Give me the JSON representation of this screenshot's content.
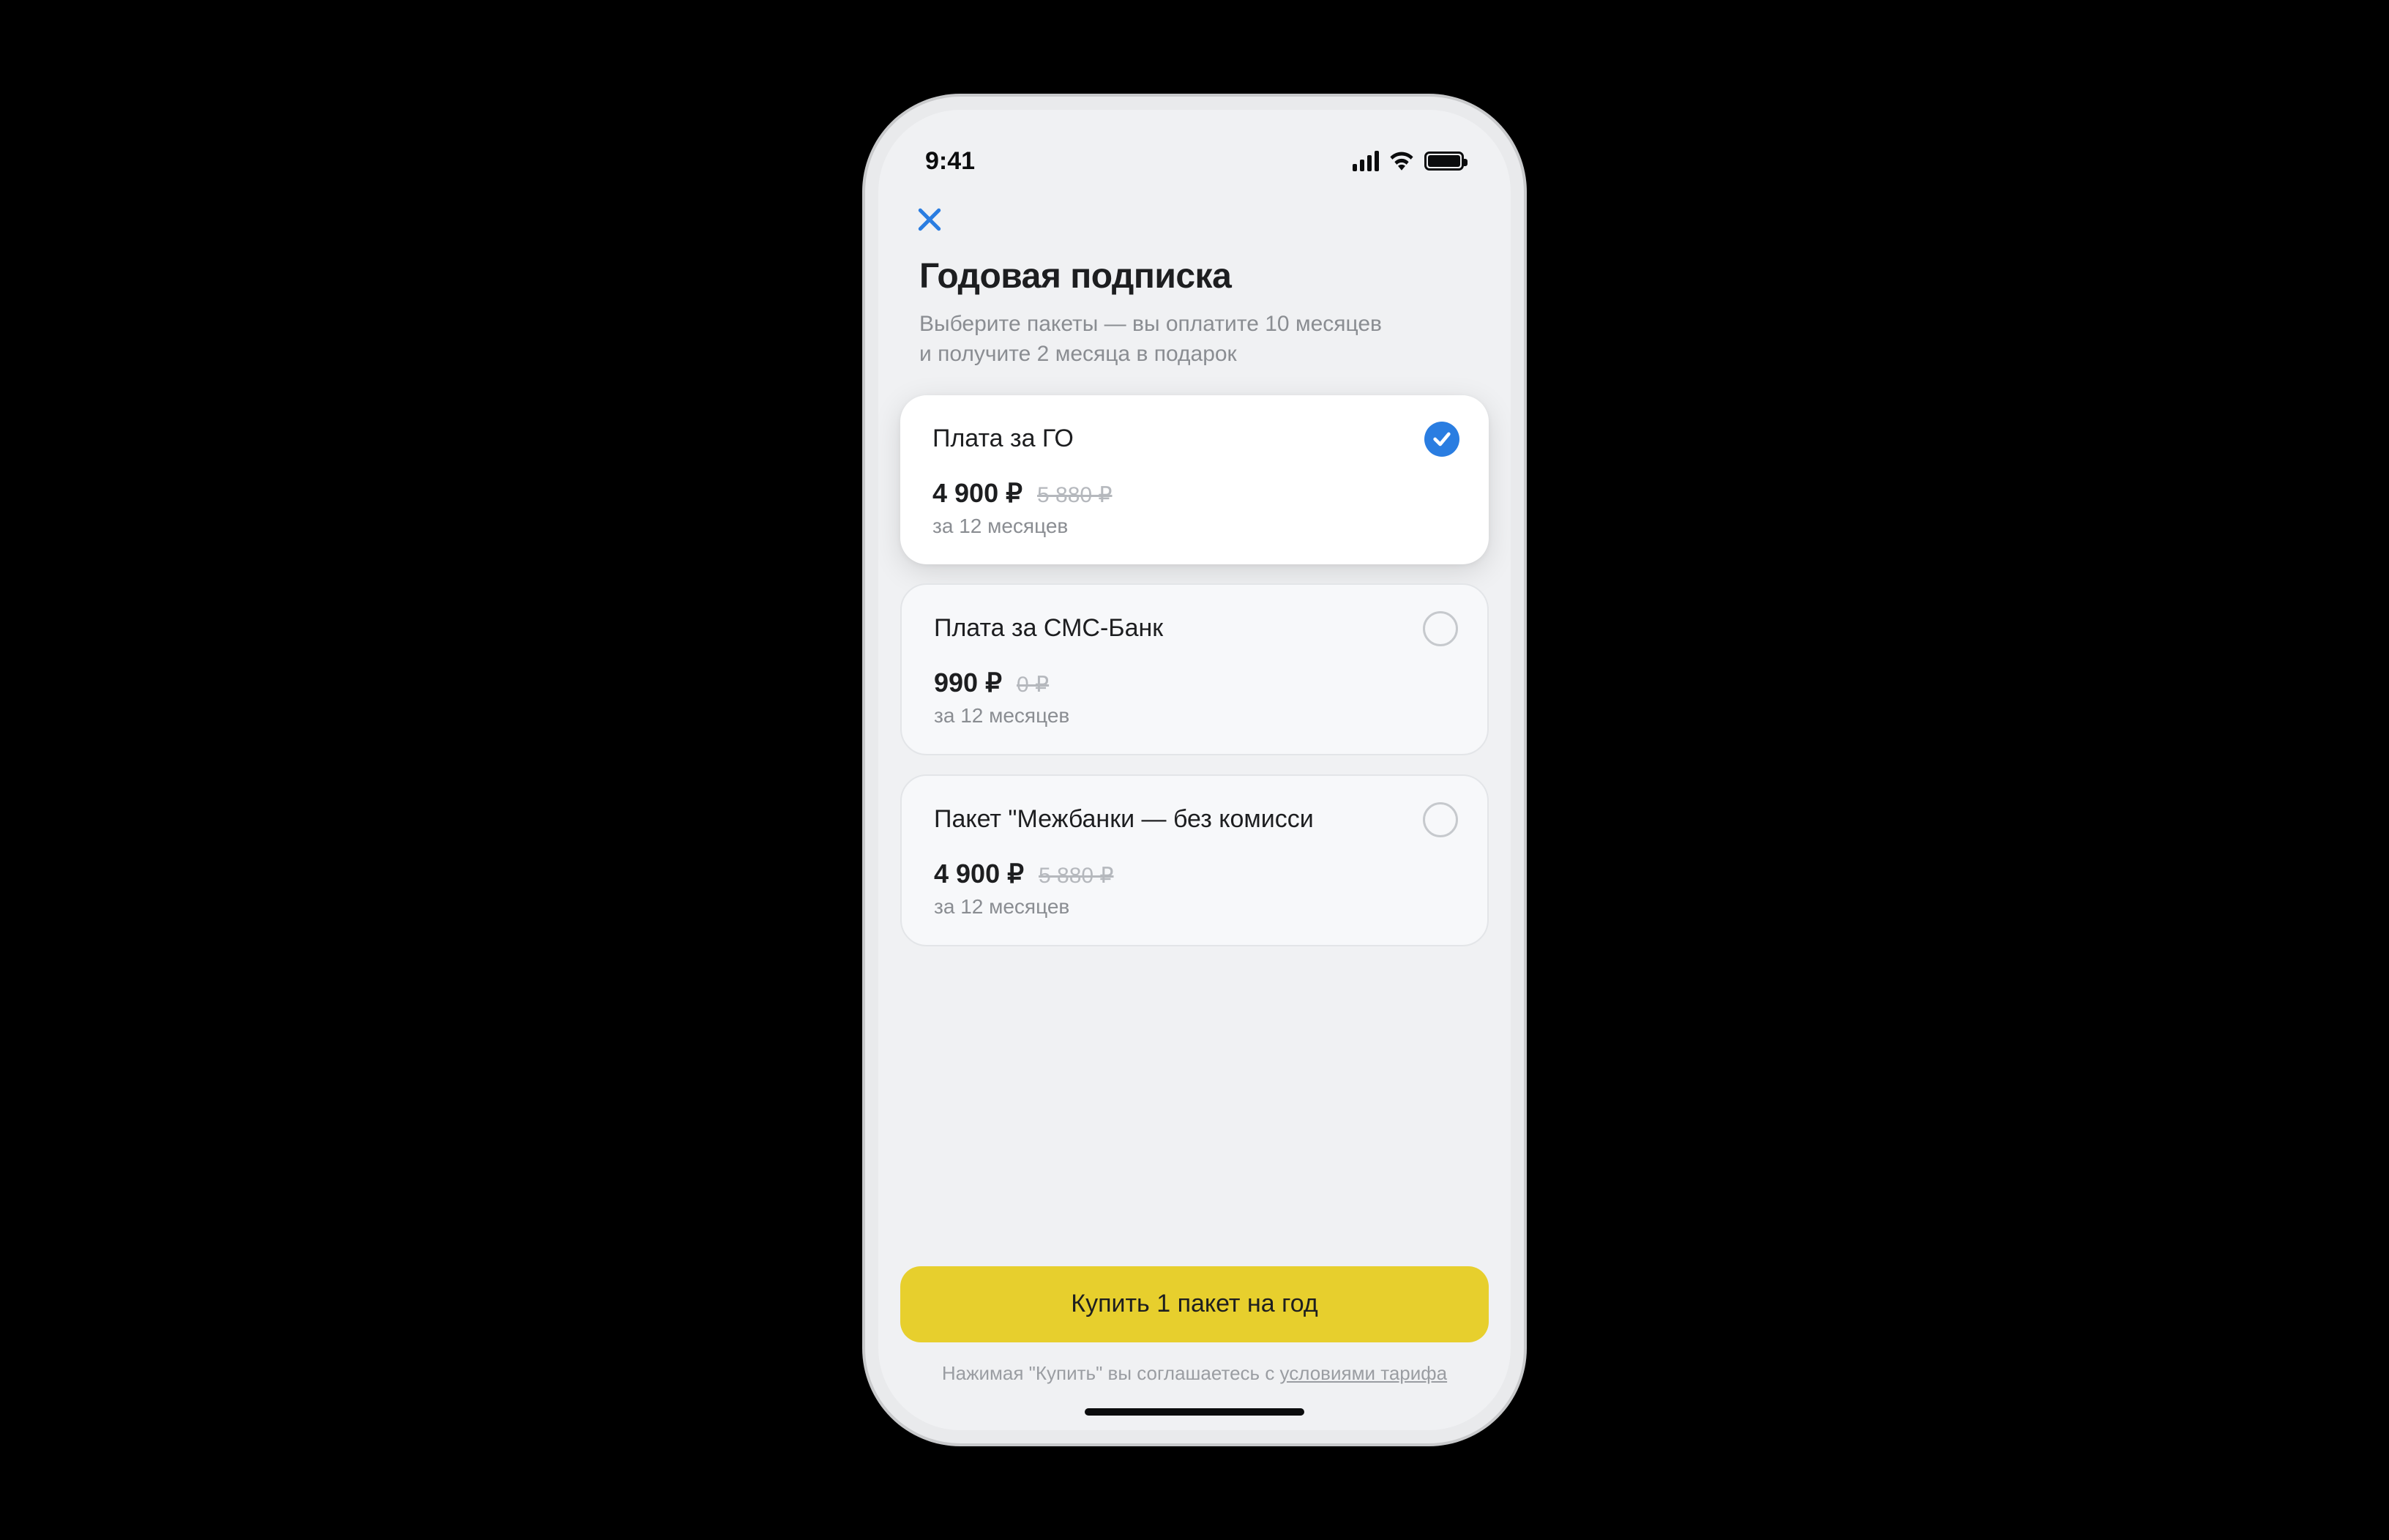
{
  "status": {
    "time": "9:41"
  },
  "nav": {
    "close_icon": "close"
  },
  "header": {
    "title": "Годовая подписка",
    "subtitle": "Выберите пакеты — вы оплатите 10 месяцев и получите 2 месяца в подарок"
  },
  "packages": [
    {
      "title": "Плата за ГО",
      "price": "4 900 ₽",
      "old_price": "5 880 ₽",
      "period": "за 12 месяцев",
      "selected": true
    },
    {
      "title": "Плата за СМС-Банк",
      "price": "990 ₽",
      "old_price": "0 ₽",
      "period": "за 12 месяцев",
      "selected": false
    },
    {
      "title": "Пакет \"Межбанки — без комисси",
      "price": "4 900 ₽",
      "old_price": "5 880 ₽",
      "period": "за 12 месяцев",
      "selected": false
    }
  ],
  "footer": {
    "buy_label": "Купить 1 пакет на год",
    "agree_prefix": "Нажимая \"Купить\" вы соглашаетесь с ",
    "agree_link": "условиями тарифа"
  }
}
